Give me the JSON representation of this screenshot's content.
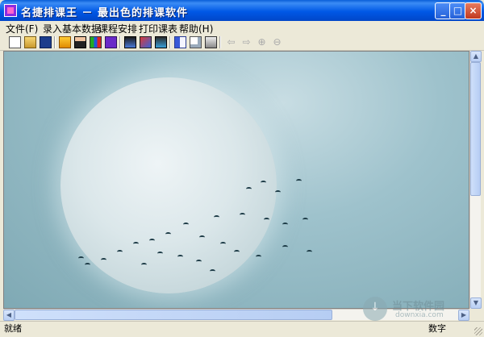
{
  "window": {
    "title": "名捷排课王 － 最出色的排课软件"
  },
  "title_buttons": {
    "minimize": "_",
    "maximize": "□",
    "close": "×"
  },
  "menu": [
    {
      "label": "文件(F)"
    },
    {
      "label": "录入基本数据"
    },
    {
      "label": "课程安排"
    },
    {
      "label": "打印课表"
    },
    {
      "label": "帮助(H)"
    }
  ],
  "toolbar": {
    "tools": [
      "new-file-icon",
      "open-folder-icon",
      "save-disk-icon",
      "home-icon",
      "teacher-icon",
      "class-grid-icon",
      "student-icon",
      "schedule-icon",
      "calendar-icon",
      "report-icon",
      "book-icon",
      "print-preview-icon",
      "printer-icon",
      "arrow-left-icon",
      "arrow-right-icon",
      "zoom-in-icon",
      "zoom-out-icon"
    ]
  },
  "statusbar": {
    "left": "就绪",
    "right": "数字"
  },
  "watermark": {
    "text": "当下软件园",
    "sub": "downxia.com"
  },
  "colors": {
    "title_bar": "#0058e6",
    "client_bg": "#9ec2cc",
    "moon": "#dbe7ea"
  }
}
